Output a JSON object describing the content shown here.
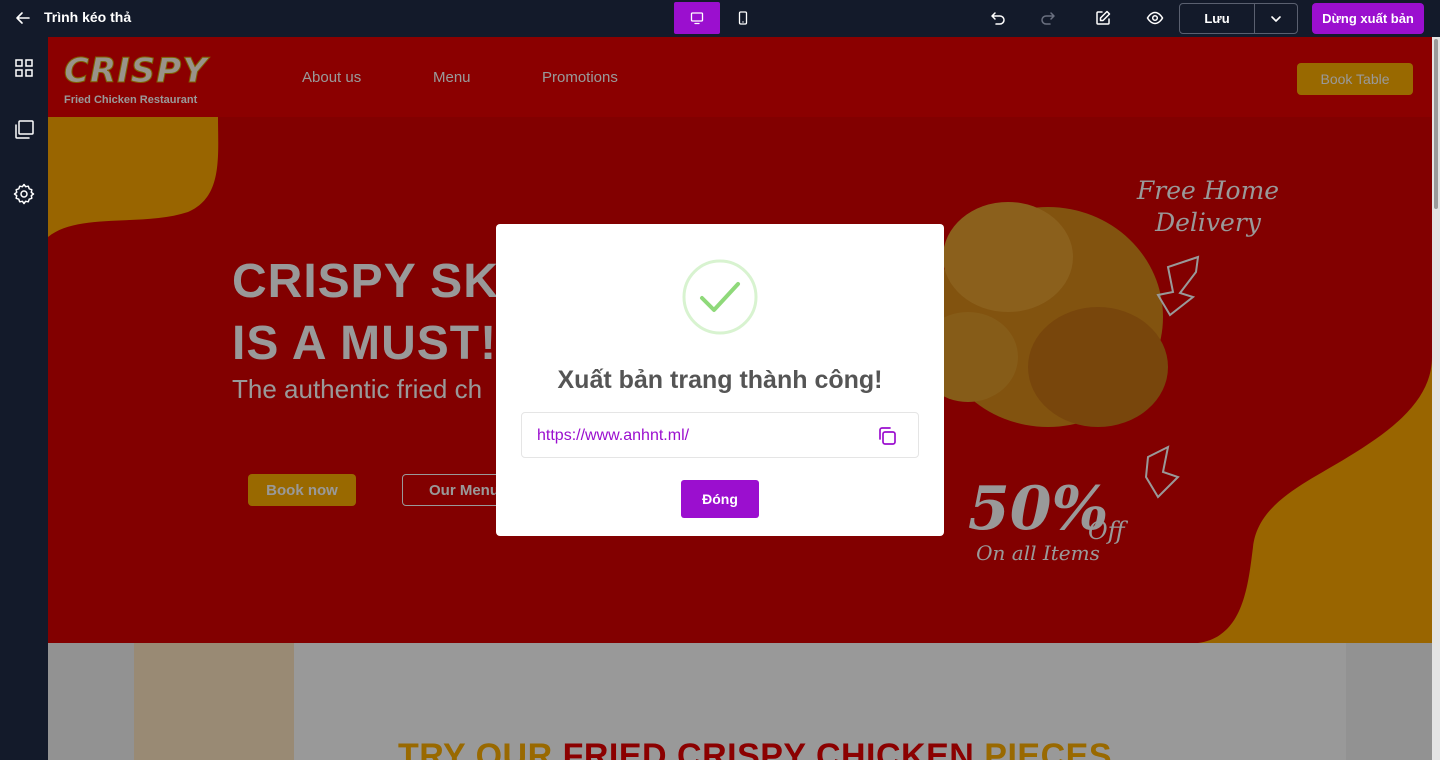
{
  "editor": {
    "title": "Trình kéo thả",
    "save_label": "Lưu",
    "publish_label": "Dừng xuất bản",
    "accent_color": "#9b0fcf"
  },
  "site": {
    "logo_text": "CRISPY",
    "logo_subtitle": "Fried Chicken Restaurant",
    "nav": [
      "About us",
      "Menu",
      "Promotions"
    ],
    "book_table": "Book Table",
    "hero_line1": "CRISPY SK",
    "hero_line2": "IS A MUST!",
    "hero_sub": "The authentic fried ch",
    "book_now": "Book now",
    "our_menu": "Our Menu",
    "promo_delivery_1": "Free Home",
    "promo_delivery_2": "Delivery",
    "promo_discount": "50%",
    "promo_off": "Off",
    "promo_items": "On all Items",
    "section_title_a": "TRY OUR ",
    "section_title_b": "FRIED CRISPY CHICKEN",
    "section_title_c": " PIECES"
  },
  "modal": {
    "title": "Xuất bản trang thành công!",
    "url": "https://www.anhnt.ml/",
    "close_label": "Đóng"
  }
}
